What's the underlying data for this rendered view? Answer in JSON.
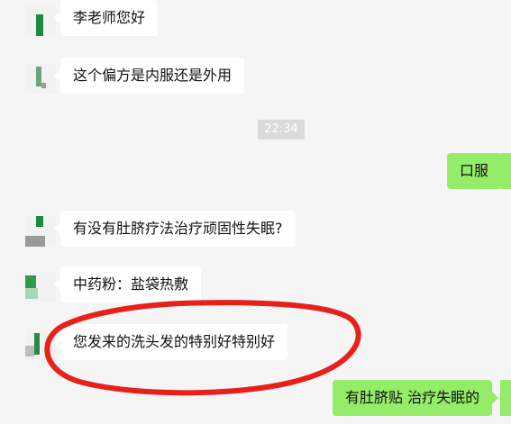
{
  "chat": {
    "messages": [
      {
        "side": "left",
        "text": "李老师您好"
      },
      {
        "side": "left",
        "text": "这个偏方是内服还是外用"
      },
      {
        "side": "right",
        "text": "口服"
      },
      {
        "side": "left",
        "text": "有没有肚脐疗法治疗顽固性失眠?"
      },
      {
        "side": "left",
        "text": "中药粉：盐袋热敷"
      },
      {
        "side": "left",
        "text": "您发来的洗头发的特别好特别好"
      },
      {
        "side": "right",
        "text": "有肚脐贴 治疗失眠的"
      }
    ],
    "time_separator": "22:34"
  },
  "colors": {
    "background": "#f5f5f5",
    "left_bubble": "#ffffff",
    "right_bubble": "#95ec69",
    "annotation": "#e8201a"
  }
}
